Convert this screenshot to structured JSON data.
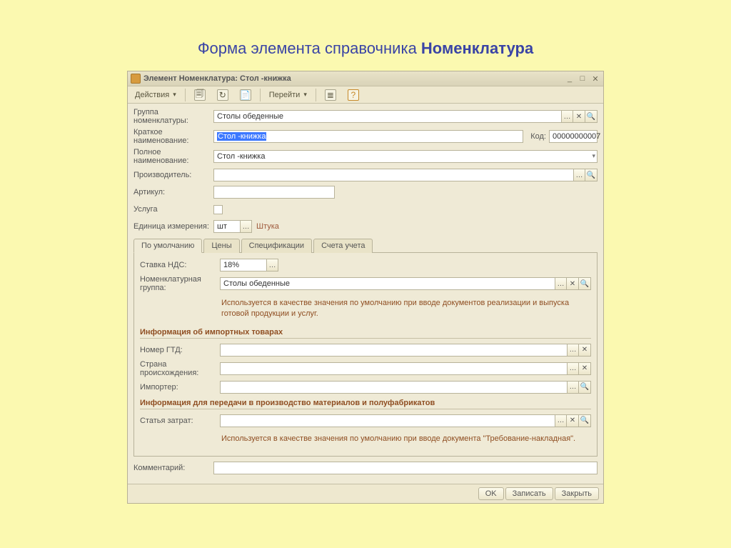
{
  "page_heading_prefix": "Форма элемента справочника ",
  "page_heading_strong": "Номенклатура",
  "title": "Элемент Номенклатура: Стол -книжка",
  "toolbar": {
    "actions": "Действия",
    "goto": "Перейти"
  },
  "labels": {
    "group": "Группа номенклатуры:",
    "short_name": "Краткое наименование:",
    "code": "Код:",
    "full_name": "Полное наименование:",
    "manufacturer": "Производитель:",
    "article": "Артикул:",
    "service": "Услуга",
    "unit": "Единица измерения:",
    "vat": "Ставка НДС:",
    "nomgroup": "Номенклатурная группа:",
    "gtd": "Номер ГТД:",
    "country": "Страна происхождения:",
    "importer": "Импортер:",
    "cost_item": "Статья затрат:",
    "comment": "Комментарий:"
  },
  "values": {
    "group": "Столы обеденные",
    "short_name": "Стол -книжка",
    "code": "00000000007",
    "full_name": "Стол -книжка",
    "manufacturer": "",
    "article": "",
    "unit": "шт",
    "unit_hint": "Штука",
    "vat": "18%",
    "nomgroup": "Столы обеденные",
    "gtd": "",
    "country": "",
    "importer": "",
    "cost_item": "",
    "comment": ""
  },
  "tabs": [
    "По умолчанию",
    "Цены",
    "Спецификации",
    "Счета учета"
  ],
  "help": {
    "nomgroup": "Используется в качестве значения по умолчанию при вводе документов  реализации и выпуска готовой продукции и услуг.",
    "cost": "Используется в качестве значения по умолчанию при вводе документа \"Требование-накладная\"."
  },
  "sections": {
    "import": "Информация об импортных товарах",
    "production": "Информация для передачи в производство материалов и полуфабрикатов"
  },
  "buttons": {
    "ok": "OK",
    "save": "Записать",
    "close": "Закрыть"
  }
}
